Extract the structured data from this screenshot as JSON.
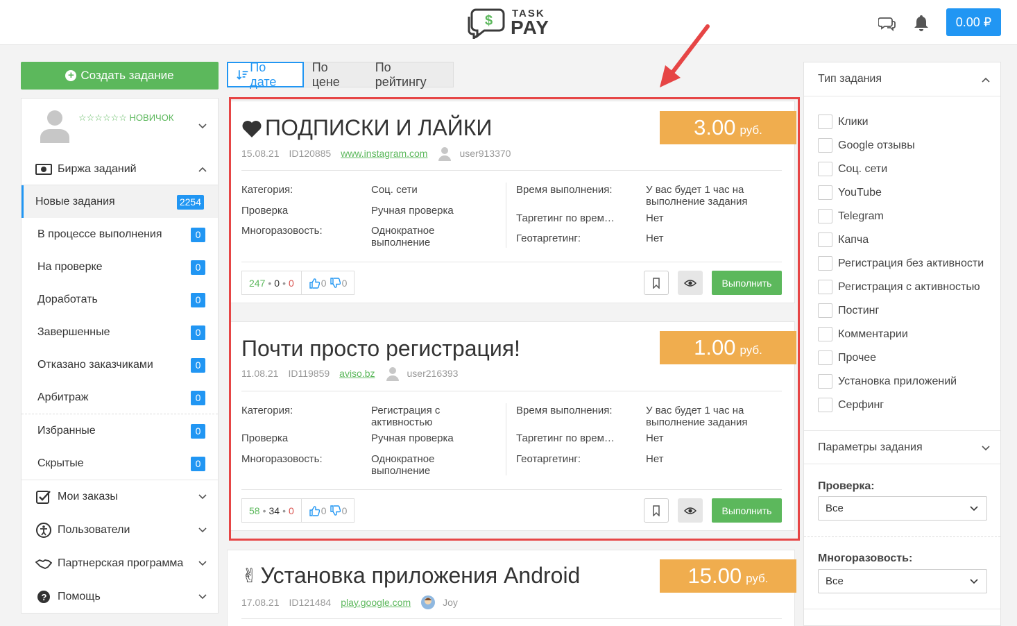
{
  "header": {
    "logo_top": "TASK",
    "logo_bottom": "PAY",
    "balance": "0.00 ₽",
    "icons": [
      "chat-icon",
      "bell-icon"
    ]
  },
  "sidebar": {
    "create_button": "Создать задание",
    "rank": "☆☆☆☆☆☆ НОВИЧОК",
    "exchange_title": "Биржа заданий",
    "items": [
      {
        "label": "Новые задания",
        "count": "2254"
      },
      {
        "label": "В процессе выполнения",
        "count": "0"
      },
      {
        "label": "На проверке",
        "count": "0"
      },
      {
        "label": "Доработать",
        "count": "0"
      },
      {
        "label": "Завершенные",
        "count": "0"
      },
      {
        "label": "Отказано заказчиками",
        "count": "0"
      },
      {
        "label": "Арбитраж",
        "count": "0"
      },
      {
        "label": "Избранные",
        "count": "0"
      },
      {
        "label": "Скрытые",
        "count": "0"
      }
    ],
    "sections": [
      {
        "label": "Мои заказы"
      },
      {
        "label": "Пользователи"
      },
      {
        "label": "Партнерская программа"
      },
      {
        "label": "Помощь"
      }
    ]
  },
  "sort": {
    "tabs": [
      "По дате",
      "По цене",
      "По рейтингу"
    ],
    "active": "По дате"
  },
  "tasks": [
    {
      "title": "ПОДПИСКИ И ЛАЙКИ",
      "price": "3.00",
      "currency": "руб.",
      "date": "15.08.21",
      "id": "ID120885",
      "site": "www.instagram.com",
      "user": "user913370",
      "category_label": "Категория:",
      "category": "Соц. сети",
      "check_label": "Проверка",
      "check": "Ручная проверка",
      "repeat_label": "Многоразовость:",
      "repeat": "Однократное выполнение",
      "time_label": "Время выполнения:",
      "time": "У вас будет 1 час на выполнение задания",
      "targeting_time_label": "Таргетинг по врем…",
      "targeting_time": "Нет",
      "geo_label": "Геотаргетинг:",
      "geo": "Нет",
      "stat_done": "247",
      "stat_mid": "0",
      "stat_fail": "0",
      "likes": "0",
      "dislikes": "0",
      "action": "Выполнить"
    },
    {
      "title": "Почти просто регистрация!",
      "price": "1.00",
      "currency": "руб.",
      "date": "11.08.21",
      "id": "ID119859",
      "site": "aviso.bz",
      "user": "user216393",
      "category_label": "Категория:",
      "category": "Регистрация с активностью",
      "check_label": "Проверка",
      "check": "Ручная проверка",
      "repeat_label": "Многоразовость:",
      "repeat": "Однократное выполнение",
      "time_label": "Время выполнения:",
      "time": "У вас будет 1 час на выполнение задания",
      "targeting_time_label": "Таргетинг по врем…",
      "targeting_time": "Нет",
      "geo_label": "Геотаргетинг:",
      "geo": "Нет",
      "stat_done": "58",
      "stat_mid": "34",
      "stat_fail": "0",
      "likes": "0",
      "dislikes": "0",
      "action": "Выполнить"
    },
    {
      "title": "Установка приложения Android",
      "price": "15.00",
      "currency": "руб.",
      "date": "17.08.21",
      "id": "ID121484",
      "site": "play.google.com",
      "user": "Joy"
    }
  ],
  "filter": {
    "type_title": "Тип задания",
    "types": [
      "Клики",
      "Google отзывы",
      "Соц. сети",
      "YouTube",
      "Telegram",
      "Капча",
      "Регистрация без активности",
      "Регистрация с активностью",
      "Постинг",
      "Комментарии",
      "Прочее",
      "Установка приложений",
      "Серфинг"
    ],
    "params_title": "Параметры задания",
    "check_label": "Проверка:",
    "check_value": "Все",
    "repeat_label": "Многоразовость:",
    "repeat_value": "Все"
  },
  "colors": {
    "accent": "#2196f3",
    "success": "#5cb85c",
    "price": "#f0ad4e",
    "highlight": "#e64545"
  }
}
